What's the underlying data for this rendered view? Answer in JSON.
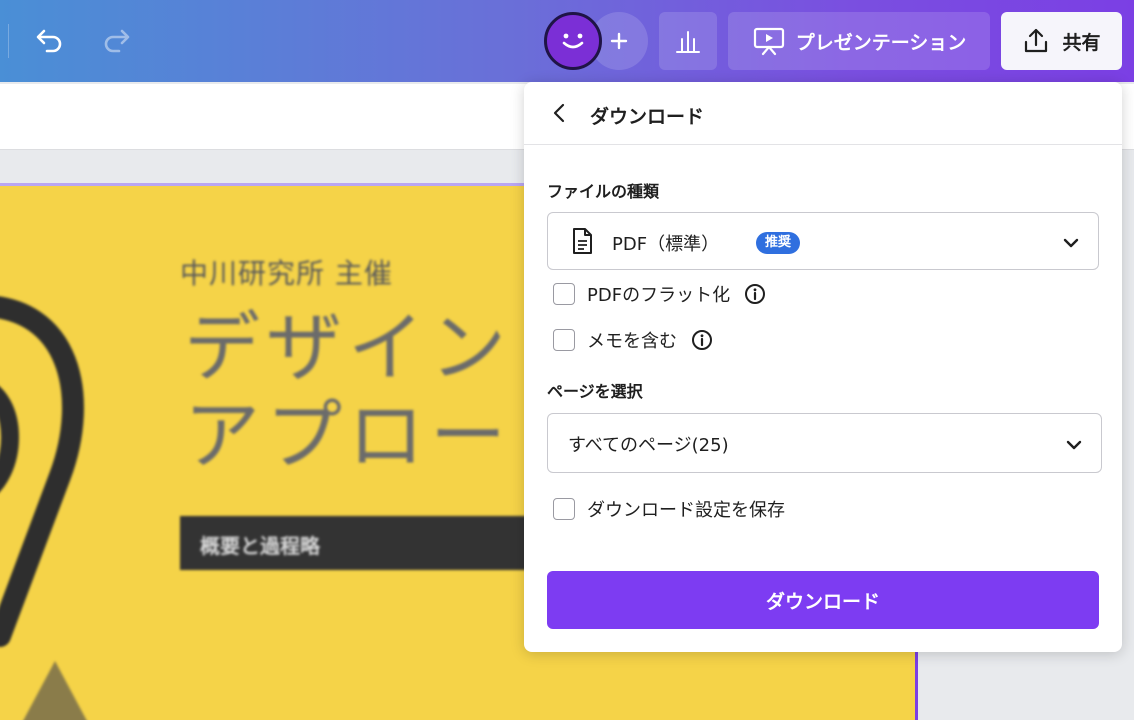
{
  "topbar": {
    "present_label": "プレゼンテーション",
    "share_label": "共有",
    "icons": [
      "undo-icon",
      "redo-icon",
      "avatar-face-icon",
      "plus-icon",
      "bar-chart-icon",
      "presentation-icon",
      "share-upload-icon"
    ]
  },
  "slide": {
    "subtitle": "中川研究所 主催",
    "title": "デザイン\nアプロー",
    "tag": "概要と過程略"
  },
  "download_panel": {
    "title": "ダウンロード",
    "file_type_label": "ファイルの種類",
    "file_type_value": "PDF（標準）",
    "recommended_badge": "推奨",
    "flatten_label": "PDFのフラット化",
    "notes_label": "メモを含む",
    "pages_label": "ページを選択",
    "pages_value": "すべてのページ(25)",
    "save_settings_label": "ダウンロード設定を保存",
    "download_button": "ダウンロード"
  },
  "colors": {
    "accent": "#7d3cf2",
    "slide_bg": "#f5d348",
    "badge": "#2f6fdf"
  }
}
